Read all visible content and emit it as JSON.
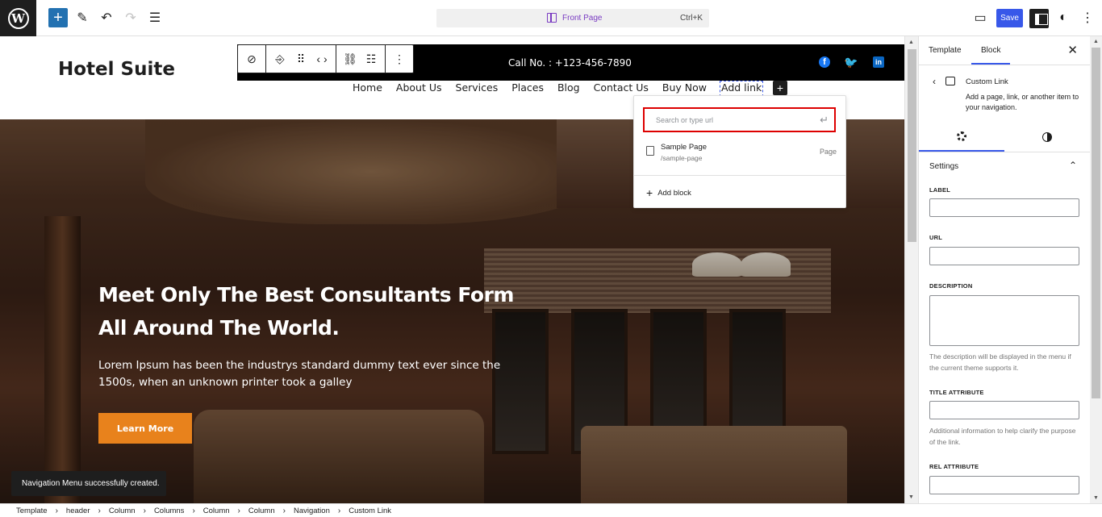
{
  "topbar": {
    "document_title": "Front Page",
    "shortcut": "Ctrl+K",
    "save_label": "Save"
  },
  "header": {
    "site_title": "Hotel Suite",
    "call_text": "Call No. : +123-456-7890",
    "nav_items": [
      "Home",
      "About Us",
      "Services",
      "Places",
      "Blog",
      "Contact Us",
      "Buy Now",
      "Add link"
    ]
  },
  "hero": {
    "heading_line1": "Meet Only The Best Consultants Form",
    "heading_line2": "All Around The World.",
    "body_line1": "Lorem Ipsum has been the industrys standard dummy text ever since the",
    "body_line2": "1500s, when an unknown printer took a galley",
    "button_label": "Learn More"
  },
  "link_popover": {
    "placeholder": "Search or type url",
    "suggestion": {
      "title": "Sample Page",
      "url": "/sample-page",
      "type": "Page"
    },
    "add_block_label": "Add block"
  },
  "snackbar": "Navigation Menu successfully created.",
  "sidebar": {
    "tabs": [
      "Template",
      "Block"
    ],
    "block_title": "Custom Link",
    "block_description": "Add a page, link, or another item to your navigation.",
    "section_title": "Settings",
    "fields": {
      "label": "LABEL",
      "url": "URL",
      "description": "DESCRIPTION",
      "description_help": "The description will be displayed in the menu if the current theme supports it.",
      "title_attribute": "TITLE ATTRIBUTE",
      "title_help": "Additional information to help clarify the purpose of the link.",
      "rel_attribute": "REL ATTRIBUTE"
    }
  },
  "breadcrumb": [
    "Template",
    "header",
    "Column",
    "Columns",
    "Column",
    "Column",
    "Navigation",
    "Custom Link"
  ],
  "colors": {
    "accent": "#3858e9",
    "cta": "#e8821c",
    "highlight_border": "#dd0000"
  }
}
